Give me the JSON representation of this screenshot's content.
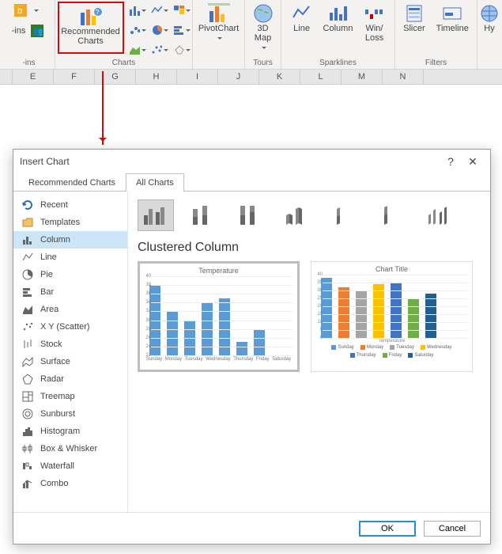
{
  "ribbon": {
    "recommended_label_1": "Recommended",
    "recommended_label_2": "Charts",
    "charts_group": "Charts",
    "pivotchart": "PivotChart",
    "tours_group": "Tours",
    "map3d": "3D\nMap",
    "sparklines_group": "Sparklines",
    "spark_line": "Line",
    "spark_column": "Column",
    "spark_winloss": "Win/\nLoss",
    "filters_group": "Filters",
    "slicer": "Slicer",
    "timeline": "Timeline",
    "hyperlink": "Hy",
    "ins_left": "-ins",
    "ins_group": "-ins"
  },
  "columns": [
    "E",
    "F",
    "G",
    "H",
    "I",
    "J",
    "K",
    "L",
    "M",
    "N"
  ],
  "dialog": {
    "title": "Insert Chart",
    "tab_recommended": "Recommended Charts",
    "tab_all": "All Charts",
    "sidebar": [
      "Recent",
      "Templates",
      "Column",
      "Line",
      "Pie",
      "Bar",
      "Area",
      "X Y (Scatter)",
      "Stock",
      "Surface",
      "Radar",
      "Treemap",
      "Sunburst",
      "Histogram",
      "Box & Whisker",
      "Waterfall",
      "Combo"
    ],
    "section_title": "Clustered Column",
    "preview1_title": "Temperature",
    "preview2_title": "Chart Title",
    "preview2_xaxis": "Temperature",
    "ok": "OK",
    "cancel": "Cancel"
  },
  "chart_data": [
    {
      "type": "bar",
      "title": "Temperature",
      "categories": [
        "Sunday",
        "Monday",
        "Tuesday",
        "Wednesday",
        "Thursday",
        "Friday",
        "Saturday"
      ],
      "values": [
        38,
        32,
        30,
        34,
        35,
        25,
        28
      ],
      "ylim": [
        22,
        40
      ],
      "yticks": [
        22,
        24,
        26,
        28,
        30,
        32,
        34,
        36,
        38,
        40
      ],
      "series_color": "#5b9bd5"
    },
    {
      "type": "bar",
      "title": "Chart Title",
      "categories": [
        "Sunday",
        "Monday",
        "Tuesday",
        "Wednesday",
        "Thursday",
        "Friday",
        "Saturday"
      ],
      "values": [
        38,
        32,
        30,
        34,
        35,
        25,
        28
      ],
      "ylim": [
        0,
        40
      ],
      "yticks": [
        0,
        5,
        10,
        15,
        20,
        25,
        30,
        35,
        40
      ],
      "legend": [
        "Sunday",
        "Monday",
        "Tuesday",
        "Wednesday",
        "Thursday",
        "Friday",
        "Saturday"
      ],
      "colors": [
        "#5b9bd5",
        "#ed7d31",
        "#a5a5a5",
        "#ffc000",
        "#4472c4",
        "#70ad47",
        "#255e91"
      ]
    }
  ]
}
